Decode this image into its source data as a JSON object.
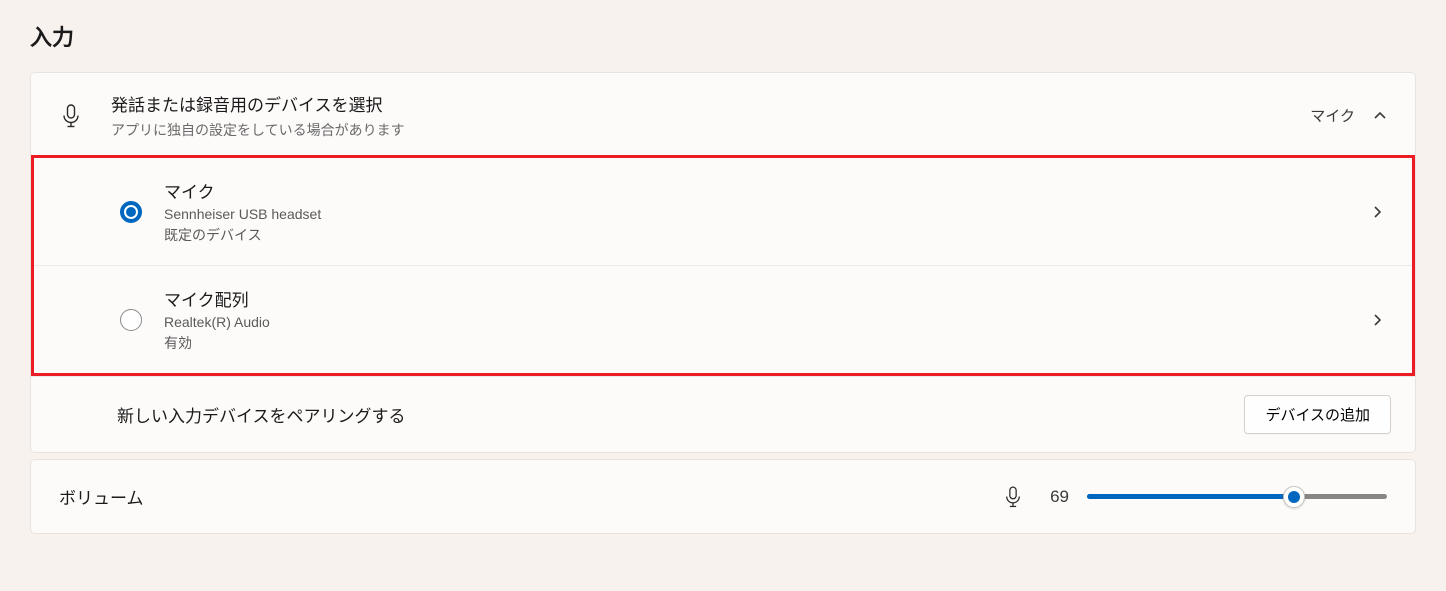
{
  "section_title": "入力",
  "header": {
    "title": "発話または録音用のデバイスを選択",
    "subtitle": "アプリに独自の設定をしている場合があります",
    "value": "マイク"
  },
  "devices": [
    {
      "selected": true,
      "title": "マイク",
      "subtitle": "Sennheiser USB headset",
      "status": "既定のデバイス"
    },
    {
      "selected": false,
      "title": "マイク配列",
      "subtitle": "Realtek(R) Audio",
      "status": "有効"
    }
  ],
  "pair": {
    "label": "新しい入力デバイスをペアリングする",
    "button": "デバイスの追加"
  },
  "volume": {
    "label": "ボリューム",
    "value": 69,
    "min": 0,
    "max": 100
  },
  "colors": {
    "accent": "#0067c0",
    "highlight_border": "#ec1c24"
  }
}
